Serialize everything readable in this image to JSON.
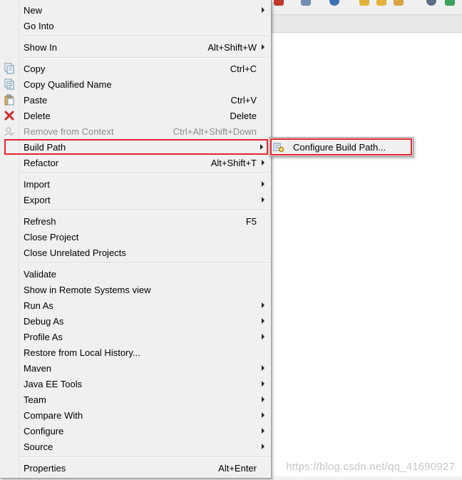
{
  "menu": {
    "items": [
      {
        "label": "New",
        "shortcut": "",
        "submenu": true
      },
      {
        "label": "Go Into",
        "shortcut": "",
        "submenu": false
      },
      {
        "label": "Show In",
        "shortcut": "Alt+Shift+W",
        "submenu": true
      },
      {
        "label": "Copy",
        "shortcut": "Ctrl+C",
        "submenu": false,
        "icon": "copy-icon"
      },
      {
        "label": "Copy Qualified Name",
        "shortcut": "",
        "submenu": false,
        "icon": "copy-qualified-name-icon"
      },
      {
        "label": "Paste",
        "shortcut": "Ctrl+V",
        "submenu": false,
        "icon": "paste-icon"
      },
      {
        "label": "Delete",
        "shortcut": "Delete",
        "submenu": false,
        "icon": "delete-icon"
      },
      {
        "label": "Remove from Context",
        "shortcut": "Ctrl+Alt+Shift+Down",
        "submenu": false,
        "disabled": true,
        "icon": "remove-context-icon"
      },
      {
        "label": "Build Path",
        "shortcut": "",
        "submenu": true,
        "highlighted": true
      },
      {
        "label": "Refactor",
        "shortcut": "Alt+Shift+T",
        "submenu": true
      },
      {
        "label": "Import",
        "shortcut": "",
        "submenu": true
      },
      {
        "label": "Export",
        "shortcut": "",
        "submenu": true
      },
      {
        "label": "Refresh",
        "shortcut": "F5",
        "submenu": false
      },
      {
        "label": "Close Project",
        "shortcut": "",
        "submenu": false
      },
      {
        "label": "Close Unrelated Projects",
        "shortcut": "",
        "submenu": false
      },
      {
        "label": "Validate",
        "shortcut": "",
        "submenu": false
      },
      {
        "label": "Show in Remote Systems view",
        "shortcut": "",
        "submenu": false
      },
      {
        "label": "Run As",
        "shortcut": "",
        "submenu": true
      },
      {
        "label": "Debug As",
        "shortcut": "",
        "submenu": true
      },
      {
        "label": "Profile As",
        "shortcut": "",
        "submenu": true
      },
      {
        "label": "Restore from Local History...",
        "shortcut": "",
        "submenu": false
      },
      {
        "label": "Maven",
        "shortcut": "",
        "submenu": true
      },
      {
        "label": "Java EE Tools",
        "shortcut": "",
        "submenu": true
      },
      {
        "label": "Team",
        "shortcut": "",
        "submenu": true
      },
      {
        "label": "Compare With",
        "shortcut": "",
        "submenu": true
      },
      {
        "label": "Configure",
        "shortcut": "",
        "submenu": true
      },
      {
        "label": "Source",
        "shortcut": "",
        "submenu": true
      },
      {
        "label": "Properties",
        "shortcut": "Alt+Enter",
        "submenu": false
      }
    ]
  },
  "submenu": {
    "label": "Configure Build Path...",
    "icon": "configure-build-path-icon"
  },
  "watermark": "https://blog.csdn.net/qq_41690927",
  "colors": {
    "highlight_border": "#e5262c",
    "menu_background": "#f0f0f0",
    "disabled_text": "#8d8d8d"
  }
}
